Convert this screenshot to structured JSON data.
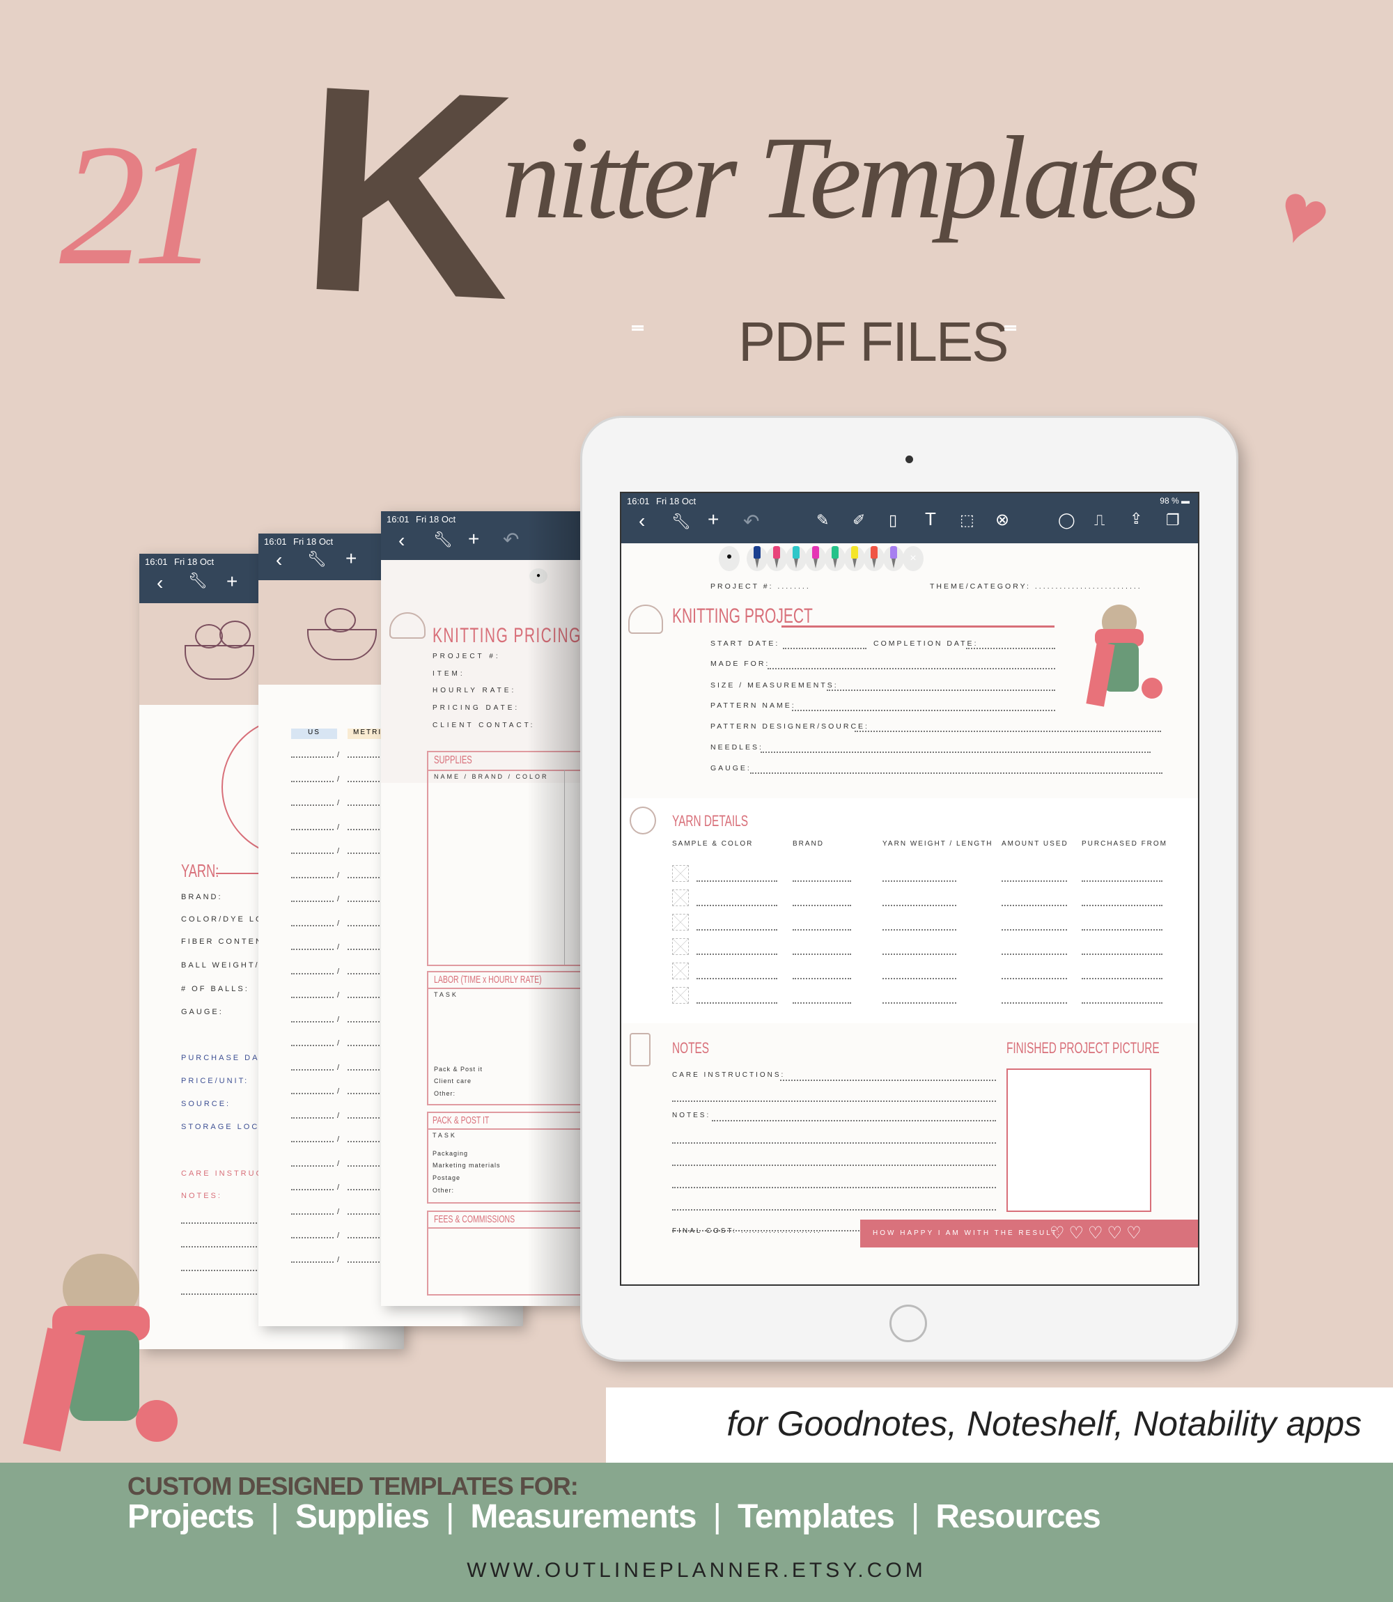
{
  "hero": {
    "count": "21",
    "title_first": "K",
    "title_rest": "nitter Templates",
    "subtitle": "PDF FILES"
  },
  "status_bar": {
    "time": "16:01",
    "date": "Fri 18 Oct",
    "battery": "98 %"
  },
  "toolbar": {
    "left_icons": [
      "back-icon",
      "wrench-icon",
      "plus-icon",
      "undo-icon"
    ],
    "tool_icons": [
      "pen-icon",
      "highlighter-icon",
      "eraser-icon",
      "text-icon",
      "lasso-icon",
      "close-icon"
    ],
    "right_icons": [
      "shapes-icon",
      "stamp-icon",
      "share-icon",
      "pages-icon"
    ]
  },
  "pen_colors": [
    "#1a3f8f",
    "#e8437a",
    "#2ec7c9",
    "#e535b5",
    "#26c28a",
    "#f4e52a",
    "#f05545",
    "#a77ff0"
  ],
  "project_page": {
    "project_no": "PROJECT #: ........",
    "theme": "THEME/CATEGORY: ..........................",
    "title": "KNITTING PROJECT",
    "fields": [
      "START DATE:",
      "MADE FOR:",
      "SIZE / MEASUREMENTS:",
      "PATTERN NAME:",
      "PATTERN DESIGNER/SOURCE:",
      "NEEDLES:",
      "GAUGE:"
    ],
    "completion": "COMPLETION DATE:",
    "yarn_title": "YARN DETAILS",
    "yarn_columns": [
      "SAMPLE & COLOR",
      "BRAND",
      "YARN WEIGHT / LENGTH",
      "AMOUNT USED",
      "PURCHASED FROM"
    ],
    "notes_title": "NOTES",
    "picture_title": "FINISHED PROJECT PICTURE",
    "care": "CARE INSTRUCTIONS:",
    "notes": "NOTES:",
    "final_cost": "FINAL COST: ....................",
    "happy": "HOW HAPPY I AM WITH THE RESULT:",
    "hearts": 5
  },
  "pricing_page": {
    "title": "KNITTING PRICING WORK",
    "fields": [
      "PROJECT #:",
      "ITEM:",
      "HOURLY RATE:",
      "PRICING DATE:",
      "CLIENT CONTACT:"
    ],
    "supplies": "SUPPLIES",
    "supplies_col": "NAME / BRAND / COLOR",
    "labor": "LABOR (TIME x HOURLY RATE)",
    "task": "TASK",
    "labor_items": [
      "Pack & Post it",
      "Client care",
      "Other:"
    ],
    "pack": "PACK & POST IT",
    "pack_items": [
      "Packaging",
      "Marketing materials",
      "Postage",
      "Other:"
    ],
    "fees": "FEES & COMMISSIONS"
  },
  "measure_page": {
    "us": "US",
    "metric": "METRI"
  },
  "yarn_page": {
    "title": "YARN:",
    "fields": [
      "BRAND:",
      "COLOR/DYE LOT:",
      "FIBER CONTENT:",
      "BALL WEIGHT/LE",
      "# OF BALLS:",
      "GAUGE:"
    ],
    "purchase_fields": [
      "PURCHASE DATE",
      "PRICE/UNIT:",
      "SOURCE:",
      "STORAGE LOCAT"
    ],
    "care": "CARE INSTRUCTI",
    "notes": "NOTES:"
  },
  "apps_line": "for Goodnotes, Noteshelf, Notability apps",
  "footer": {
    "heading": "CUSTOM DESIGNED TEMPLATES FOR:",
    "categories": [
      "Projects",
      "Supplies",
      "Measurements",
      "Templates",
      "Resources"
    ],
    "url": "WWW.OUTLINEPLANNER.ETSY.COM"
  }
}
